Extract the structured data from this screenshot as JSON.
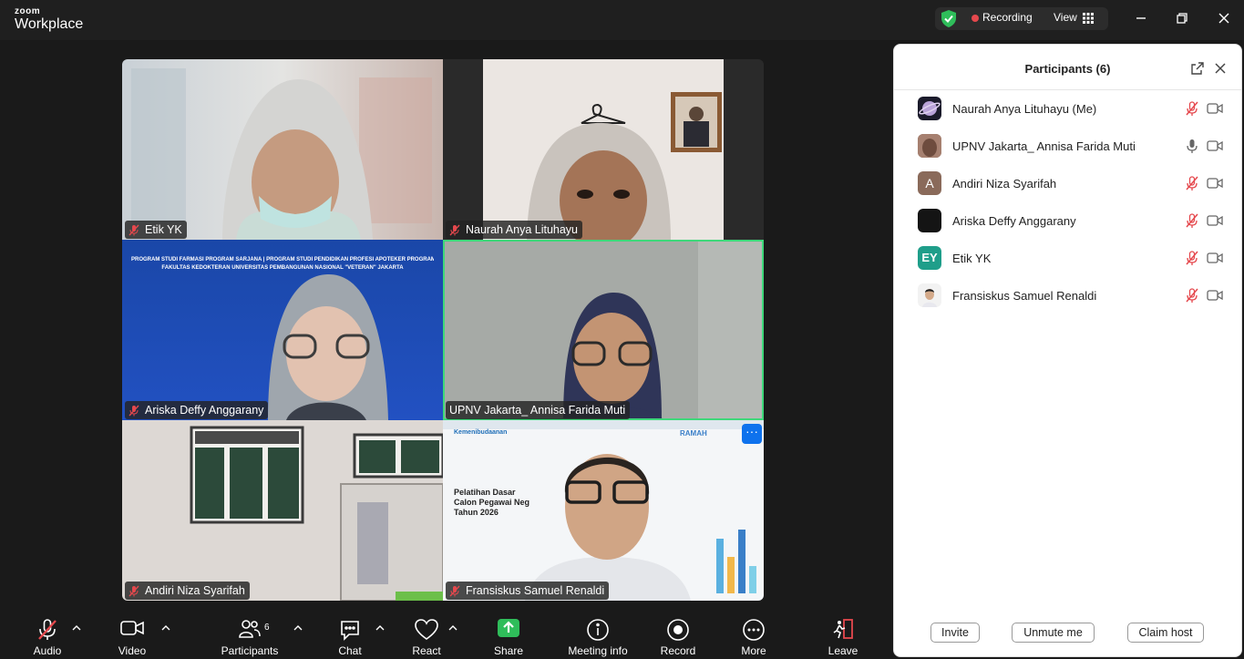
{
  "app": {
    "brand_small": "zoom",
    "brand_big": "Workplace"
  },
  "topbar": {
    "recording_label": "Recording",
    "view_label": "View"
  },
  "colors": {
    "accent_green": "#3ed87a",
    "record_red": "#e5484d",
    "zoom_blue": "#0e72ed",
    "mute_red": "#e5484d"
  },
  "tiles": [
    {
      "name": "Etik YK",
      "muted": true
    },
    {
      "name": "Naurah Anya Lituhayu",
      "muted": true
    },
    {
      "name": "Ariska Deffy Anggarany",
      "muted": true
    },
    {
      "name": "UPNV Jakarta_ Annisa Farida Muti",
      "muted": false,
      "active": true
    },
    {
      "name": "Andiri Niza Syarifah",
      "muted": true
    },
    {
      "name": "Fransiskus Samuel Renaldi",
      "muted": true,
      "more_icon": "ellipsis-icon"
    }
  ],
  "slides": {
    "banner_line1": "PROGRAM STUDI FARMASI PROGRAM SARJANA | PROGRAM STUDI PENDIDIKAN PROFESI APOTEKER PROGRAM PROFESI",
    "banner_line2": "FAKULTAS KEDOKTERAN UNIVERSITAS PEMBANGUNAN NASIONAL \"VETERAN\" JAKARTA",
    "training_line1": "Pelatihan Dasar",
    "training_line2": "Calon Pegawai Neg",
    "training_line3": "Tahun 2026",
    "logo_text": "Kemenibudaanan",
    "tag_ramah": "RAMAH"
  },
  "panel": {
    "title": "Participants (6)",
    "participants": [
      {
        "name": "Naurah Anya Lituhayu (Me)",
        "avatar": "image",
        "mic": "muted"
      },
      {
        "name": "UPNV Jakarta_ Annisa Farida Muti",
        "avatar": "image",
        "mic": "on"
      },
      {
        "name": "Andiri Niza Syarifah",
        "avatar_initials": "A",
        "avatar_color": "#8a6a5a",
        "mic": "muted"
      },
      {
        "name": "Ariska Deffy Anggarany",
        "avatar": "image",
        "mic": "muted"
      },
      {
        "name": "Etik YK",
        "avatar_initials": "EY",
        "avatar_color": "#1f9e8a",
        "mic": "muted"
      },
      {
        "name": "Fransiskus Samuel Renaldi",
        "avatar": "image",
        "mic": "muted"
      }
    ],
    "buttons": {
      "invite": "Invite",
      "unmute": "Unmute me",
      "claim": "Claim host"
    }
  },
  "toolbar": {
    "audio": "Audio",
    "video": "Video",
    "participants": "Participants",
    "participants_count": "6",
    "chat": "Chat",
    "react": "React",
    "share": "Share",
    "meeting_info": "Meeting info",
    "record": "Record",
    "more": "More",
    "leave": "Leave"
  }
}
